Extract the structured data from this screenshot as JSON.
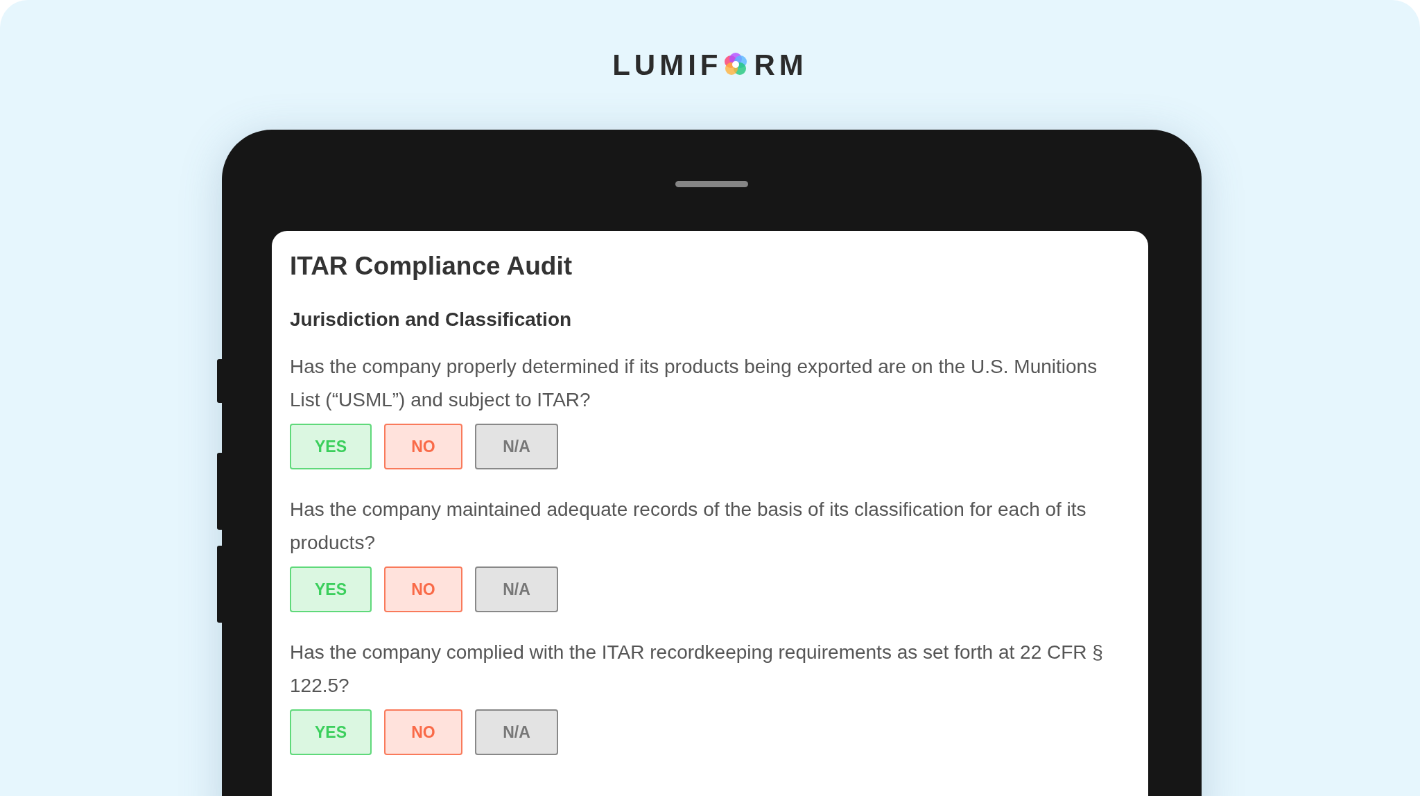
{
  "logo": {
    "before": "LUMIF",
    "after": "RM"
  },
  "form": {
    "title": "ITAR Compliance Audit",
    "section": "Jurisdiction and Classification",
    "questions": [
      {
        "text": "Has the company properly determined if its products being exported are on the U.S. Munitions List (“USML”) and subject to ITAR?",
        "answers": [
          {
            "label": "YES",
            "kind": "yes"
          },
          {
            "label": "NO",
            "kind": "no"
          },
          {
            "label": "N/A",
            "kind": "na"
          }
        ]
      },
      {
        "text": "Has the company maintained adequate records of the basis of its classification for each of its products?",
        "answers": [
          {
            "label": "YES",
            "kind": "yes"
          },
          {
            "label": "NO",
            "kind": "no"
          },
          {
            "label": "N/A",
            "kind": "na"
          }
        ]
      },
      {
        "text": "Has the company complied with the ITAR recordkeeping requirements as set forth at 22 CFR § 122.5?",
        "answers": [
          {
            "label": "YES",
            "kind": "yes"
          },
          {
            "label": "NO",
            "kind": "no"
          },
          {
            "label": "N/A",
            "kind": "na"
          }
        ]
      }
    ]
  }
}
